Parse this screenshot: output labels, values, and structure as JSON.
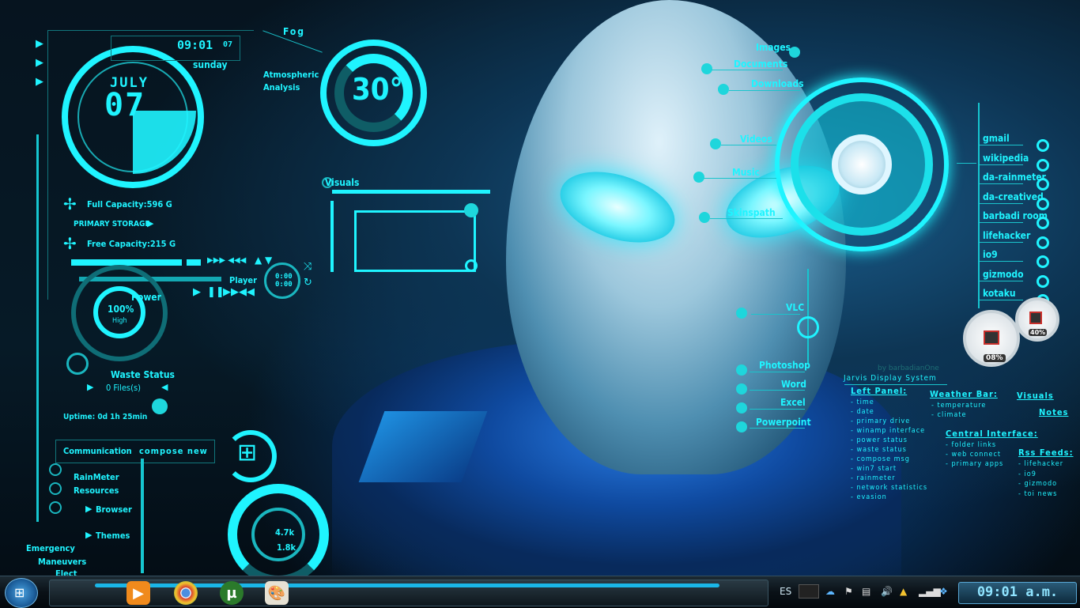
{
  "clock": {
    "time": "09:01",
    "seconds": "07",
    "weekday": "sunday",
    "month": "JULY",
    "day": "07"
  },
  "weather": {
    "label": "Fog",
    "temperature": "30°",
    "caption_line1": "Atmospheric",
    "caption_line2": "Analysis"
  },
  "storage": {
    "full_capacity": "Full Capacity:596 G",
    "primary_storage": "PRIMARY STORAGE",
    "free_capacity": "Free Capacity:215 G"
  },
  "player": {
    "label": "Player",
    "time_elapsed": "0:00",
    "time_total": "0:00"
  },
  "power": {
    "label": "Power",
    "percent": "100%",
    "state": "High"
  },
  "waste": {
    "label": "Waste Status",
    "files": "0 Files(s)"
  },
  "uptime": "Uptime: 0d 1h 25min",
  "communication": {
    "label": "Communication",
    "compose": "compose new"
  },
  "rainmeter": {
    "line1": "RainMeter",
    "line2": "Resources",
    "browser": "Browser",
    "themes": "Themes"
  },
  "emergency": {
    "line1": "Emergency",
    "line2": "Maneuvers",
    "line3": "Elect"
  },
  "network": {
    "up": "4.7k",
    "down": "1.8k"
  },
  "visuals": {
    "label": "Visuals"
  },
  "folders": {
    "images": "Images",
    "documents": "Documents",
    "downloads": "Downloads",
    "videos": "Videos",
    "music": "Music",
    "skinspath": "Skinspath"
  },
  "apps": {
    "vlc": "VLC",
    "photoshop": "Photoshop",
    "word": "Word",
    "excel": "Excel",
    "powerpoint": "Powerpoint"
  },
  "web_links": [
    "gmail",
    "wikipedia",
    "da-rainmeter",
    "da-creatived",
    "barbadi room",
    "lifehacker",
    "io9",
    "gizmodo",
    "kotaku"
  ],
  "gauges": {
    "cpu": "08%",
    "ram": "40%"
  },
  "credits": {
    "author": "by barbadianOne",
    "title": "Jarvis Display System"
  },
  "notes": {
    "left_panel_title": "Left Panel:",
    "left_panel_items": [
      "- time",
      "- date",
      "- primary drive",
      "- winamp interface",
      "- power status",
      "- waste status",
      "- compose msg",
      "- win7 start",
      "- rainmeter",
      "- network statistics",
      "- evasion"
    ],
    "weather_bar_title": "Weather Bar:",
    "weather_bar_items": [
      "- temperature",
      "- climate"
    ],
    "visuals_title": "Visuals",
    "notes_title": "Notes",
    "central_title": "Central Interface:",
    "central_items": [
      "- folder links",
      "- web connect",
      "- primary apps"
    ],
    "rss_title": "Rss Feeds:",
    "rss_items": [
      "- lifehacker",
      "- io9",
      "- gizmodo",
      "- toi news"
    ]
  },
  "taskbar": {
    "language": "ES",
    "clock": "09:01 a.m.",
    "pinned": [
      "windows-media-player-icon",
      "chrome-icon",
      "utorrent-icon",
      "paint-icon"
    ]
  }
}
